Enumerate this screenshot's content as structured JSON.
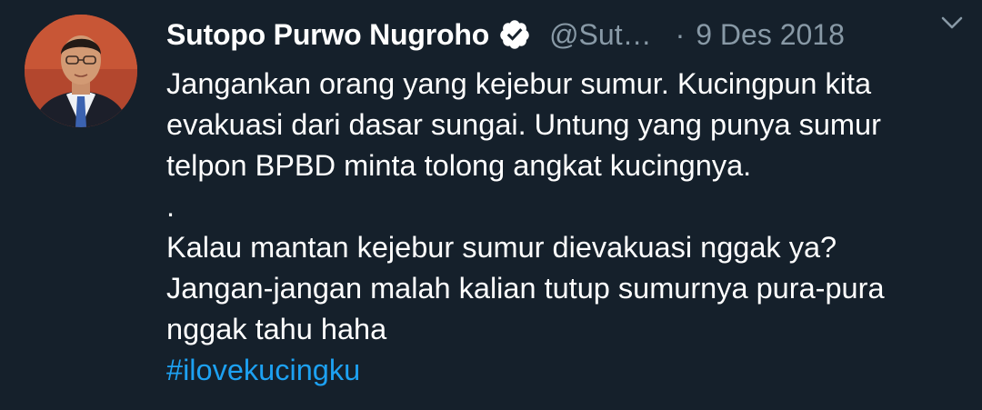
{
  "tweet": {
    "author": {
      "name": "Sutopo Purwo Nugroho",
      "handle": "@Sut…",
      "verified": true,
      "avatar_icon": "profile-photo"
    },
    "separator": "·",
    "date": "9 Des 2018",
    "menu_icon": "chevron-down-icon",
    "body_lines": [
      "Jangankan orang yang kejebur sumur. Kucingpun kita",
      "evakuasi dari dasar sungai. Untung yang punya sumur",
      "telpon BPBD minta tolong angkat kucingnya.",
      ".",
      "Kalau mantan kejebur sumur dievakuasi nggak ya?",
      "Jangan-jangan malah kalian tutup sumurnya pura-pura",
      "nggak tahu haha"
    ],
    "hashtag": "#ilovekucingku"
  },
  "colors": {
    "background": "#15202b",
    "text": "#ffffff",
    "muted": "#8899a6",
    "link": "#1da1f2"
  }
}
